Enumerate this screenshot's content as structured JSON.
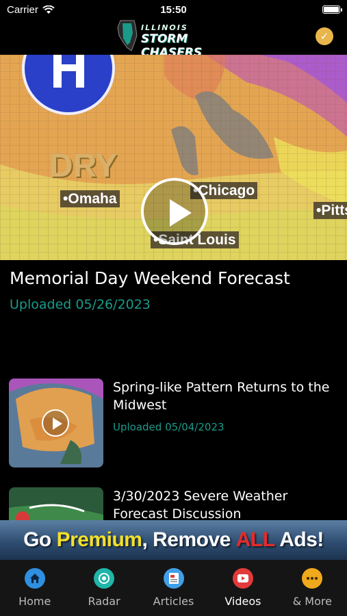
{
  "status_bar": {
    "carrier": "Carrier",
    "time": "15:50"
  },
  "header": {
    "logo_line1": "ILLINOIS",
    "logo_line2": "STORM CHASERS"
  },
  "hero": {
    "title": "Memorial Day Weekend Forecast",
    "uploaded": "Uploaded 05/26/2023",
    "map_labels": {
      "dry": "DRY",
      "omaha": "Omaha",
      "chicago": "Chicago",
      "saint_louis": "Saint Louis",
      "pitts": "Pitts"
    }
  },
  "videos": [
    {
      "title": "Spring-like Pattern Returns to the Midwest",
      "uploaded": "Uploaded 05/04/2023"
    },
    {
      "title": "3/30/2023 Severe Weather Forecast Discussion"
    }
  ],
  "ad": {
    "part1": "Go ",
    "part2": "Premium",
    "part3": ", Remove ",
    "part4": "ALL",
    "part5": " Ads!"
  },
  "tabs": [
    {
      "label": "Home",
      "icon": "home-icon",
      "color": "#2f8fe0"
    },
    {
      "label": "Radar",
      "icon": "radar-icon",
      "color": "#1fb5a8"
    },
    {
      "label": "Articles",
      "icon": "articles-icon",
      "color": "#3fa0e8"
    },
    {
      "label": "Videos",
      "icon": "videos-icon",
      "color": "#e23a3a",
      "active": true
    },
    {
      "label": "& More",
      "icon": "more-icon",
      "color": "#f0a81c"
    }
  ],
  "colors": {
    "accent": "#1a9b8a",
    "background": "#000000"
  }
}
